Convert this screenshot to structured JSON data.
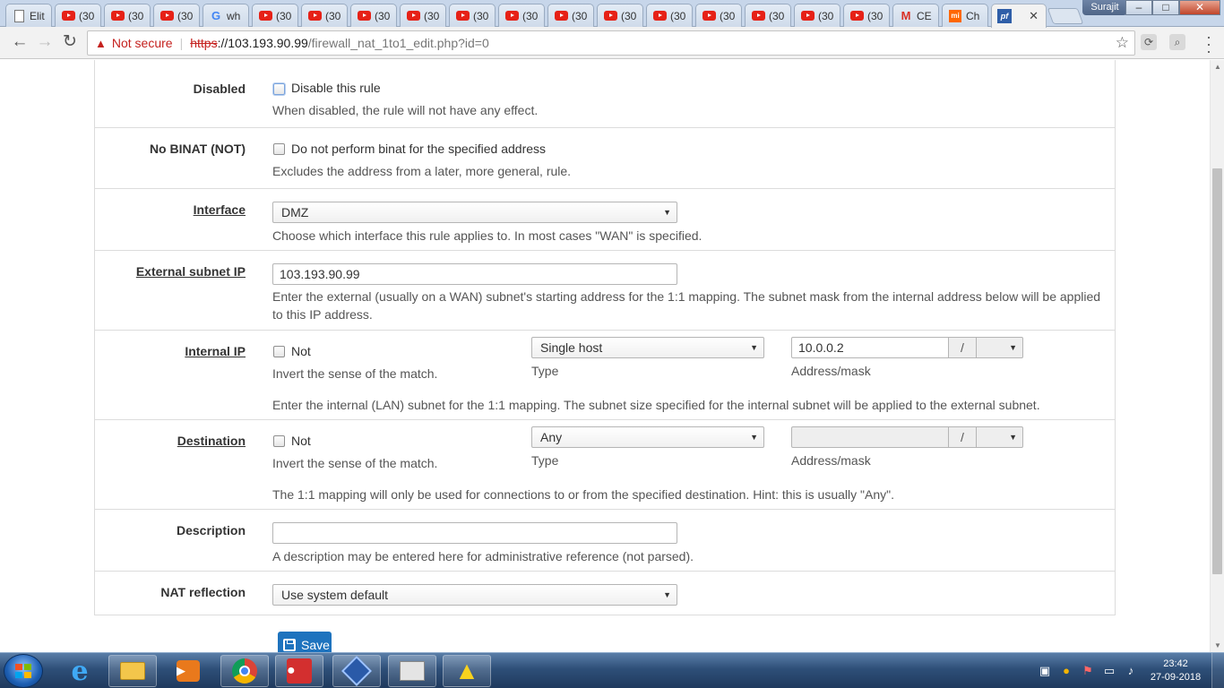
{
  "browser": {
    "tabs": [
      {
        "label": "Elit",
        "icon": "page-icon"
      },
      {
        "label": "(30",
        "icon": "youtube-icon"
      },
      {
        "label": "(30",
        "icon": "youtube-icon"
      },
      {
        "label": "(30",
        "icon": "youtube-icon"
      },
      {
        "label": "wh",
        "icon": "google-icon"
      },
      {
        "label": "(30",
        "icon": "youtube-icon"
      },
      {
        "label": "(30",
        "icon": "youtube-icon"
      },
      {
        "label": "(30",
        "icon": "youtube-icon"
      },
      {
        "label": "(30",
        "icon": "youtube-icon"
      },
      {
        "label": "(30",
        "icon": "youtube-icon"
      },
      {
        "label": "(30",
        "icon": "youtube-icon"
      },
      {
        "label": "(30",
        "icon": "youtube-icon"
      },
      {
        "label": "(30",
        "icon": "youtube-icon"
      },
      {
        "label": "(30",
        "icon": "youtube-icon"
      },
      {
        "label": "(30",
        "icon": "youtube-icon"
      },
      {
        "label": "(30",
        "icon": "youtube-icon"
      },
      {
        "label": "(30",
        "icon": "youtube-icon"
      },
      {
        "label": "(30",
        "icon": "youtube-icon"
      },
      {
        "label": "CE",
        "icon": "gmail-icon"
      },
      {
        "label": "Ch",
        "icon": "mi-icon"
      },
      {
        "label": "",
        "icon": "pfsense-icon",
        "active": true
      }
    ],
    "user": "Surajit",
    "window_buttons": {
      "minimize": "–",
      "maximize": "□",
      "close": "✕"
    },
    "nav": {
      "back": "←",
      "forward": "→",
      "reload": "↻"
    },
    "address": {
      "security_label": "Not secure",
      "scheme": "https",
      "host": "://103.193.90.99",
      "path": "/firewall_nat_1to1_edit.php?id=0"
    },
    "star": "☆"
  },
  "form": {
    "disabled": {
      "label": "Disabled",
      "checkbox_label": "Disable this rule",
      "help": "When disabled, the rule will not have any effect."
    },
    "nobinat": {
      "label": "No BINAT (NOT)",
      "checkbox_label": "Do not perform binat for the specified address",
      "help": "Excludes the address from a later, more general, rule."
    },
    "interface": {
      "label": "Interface",
      "value": "DMZ",
      "help": "Choose which interface this rule applies to. In most cases \"WAN\" is specified."
    },
    "external": {
      "label": "External subnet IP",
      "value": "103.193.90.99",
      "help": "Enter the external (usually on a WAN) subnet's starting address for the 1:1 mapping. The subnet mask from the internal address below will be applied to this IP address."
    },
    "internal": {
      "label": "Internal IP",
      "not_label": "Not",
      "not_help": "Invert the sense of the match.",
      "type_value": "Single host",
      "type_label": "Type",
      "address_value": "10.0.0.2",
      "slash": "/",
      "address_label": "Address/mask",
      "help": "Enter the internal (LAN) subnet for the 1:1 mapping. The subnet size specified for the internal subnet will be applied to the external subnet."
    },
    "destination": {
      "label": "Destination",
      "not_label": "Not",
      "not_help": "Invert the sense of the match.",
      "type_value": "Any",
      "type_label": "Type",
      "address_value": "",
      "slash": "/",
      "address_label": "Address/mask",
      "help": "The 1:1 mapping will only be used for connections to or from the specified destination. Hint: this is usually \"Any\"."
    },
    "description": {
      "label": "Description",
      "value": "",
      "help": "A description may be entered here for administrative reference (not parsed)."
    },
    "natreflection": {
      "label": "NAT reflection",
      "value": "Use system default"
    },
    "save_label": "Save"
  },
  "taskbar": {
    "apps": [
      "internet-explorer-icon",
      "file-explorer-icon",
      "media-player-icon",
      "chrome-icon",
      "video-app-icon",
      "virtualbox-icon",
      "document-app-icon",
      "warning-app-icon"
    ],
    "time": "23:42",
    "date": "27-09-2018"
  },
  "colors": {
    "accent": "#1e73be",
    "panel_header": "#424242",
    "not_secure": "#c5221f"
  }
}
